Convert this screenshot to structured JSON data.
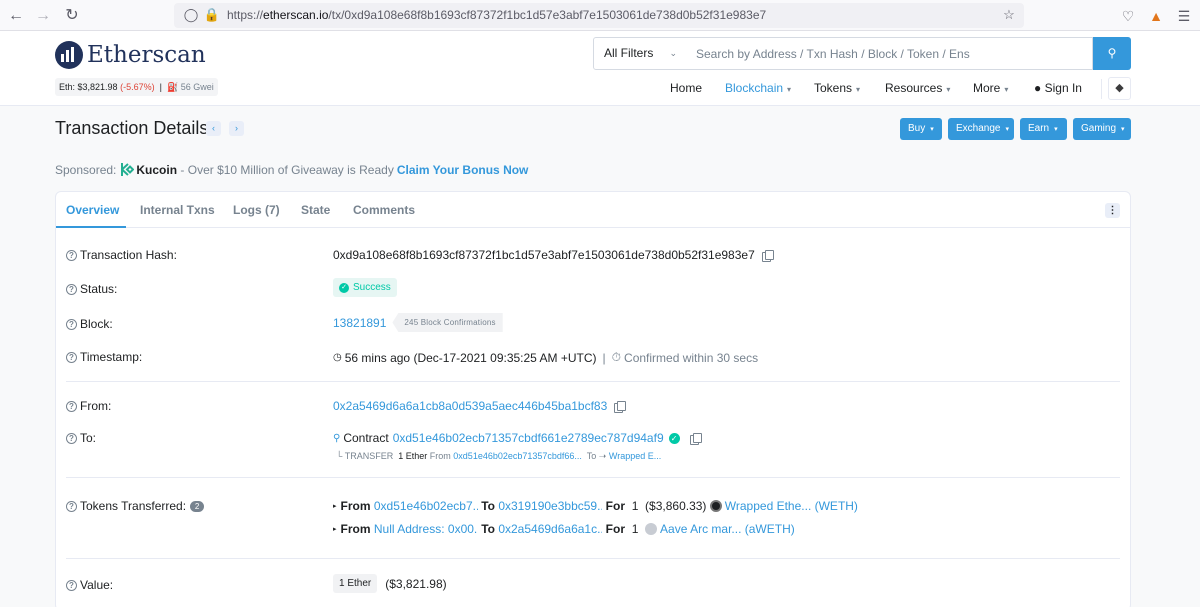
{
  "browser": {
    "url_prefix": "https://",
    "url_domain": "etherscan.io",
    "url_path": "/tx/0xd9a108e68f8b1693cf87372f1bc1d57e3abf7e1503061de738d0b52f31e983e7"
  },
  "header": {
    "logo_text": "Etherscan",
    "eth_price_label": "Eth: $3,821.98",
    "eth_change": "(-5.67%)",
    "separator": "|",
    "gas": "56 Gwei",
    "filter_label": "All Filters",
    "search_placeholder": "Search by Address / Txn Hash / Block / Token / Ens",
    "nav": {
      "home": "Home",
      "blockchain": "Blockchain",
      "tokens": "Tokens",
      "resources": "Resources",
      "more": "More",
      "signin": "Sign In"
    }
  },
  "page": {
    "title": "Transaction Details",
    "buttons": {
      "buy": "Buy",
      "exchange": "Exchange",
      "earn": "Earn",
      "gaming": "Gaming"
    }
  },
  "sponsored": {
    "label": "Sponsored:",
    "brand": "Kucoin",
    "text": "- Over $10 Million of Giveaway is Ready",
    "cta": "Claim Your Bonus Now"
  },
  "tabs": [
    "Overview",
    "Internal Txns",
    "Logs (7)",
    "State",
    "Comments"
  ],
  "details": {
    "hash_label": "Transaction Hash:",
    "hash": "0xd9a108e68f8b1693cf87372f1bc1d57e3abf7e1503061de738d0b52f31e983e7",
    "status_label": "Status:",
    "status": "Success",
    "block_label": "Block:",
    "block": "13821891",
    "confirmations": "245 Block Confirmations",
    "timestamp_label": "Timestamp:",
    "timestamp": "56 mins ago (Dec-17-2021 09:35:25 AM +UTC)",
    "ts_sep": "|",
    "confirmed_within": "Confirmed within 30 secs",
    "from_label": "From:",
    "from": "0x2a5469d6a6a1cb8a0d539a5aec446b45ba1bcf83",
    "to_label": "To:",
    "contract_label": "Contract",
    "to": "0xd51e46b02ecb71357cbdf661e2789ec787d94af9",
    "transfer_prefix": "└ TRANSFER",
    "transfer_amount": "1 Ether",
    "transfer_from_label": "From",
    "transfer_from": "0xd51e46b02ecb71357cbdf66...",
    "transfer_to_label": "To",
    "transfer_to": "Wrapped E...",
    "tokens_label": "Tokens Transferred:",
    "tokens_count": "2",
    "token_rows": [
      {
        "from_label": "From",
        "from": "0xd51e46b02ecb7...",
        "to_label": "To",
        "to": "0x319190e3bbc59...",
        "for_label": "For",
        "amount": "1",
        "usd": "($3,860.33)",
        "token": "Wrapped Ethe... (WETH)"
      },
      {
        "from_label": "From",
        "from": "Null Address: 0x00...",
        "to_label": "To",
        "to": "0x2a5469d6a6a1c...",
        "for_label": "For",
        "amount": "1",
        "usd": "",
        "token": "Aave Arc mar... (aWETH)"
      }
    ],
    "value_label": "Value:",
    "value": "1 Ether",
    "value_usd": "($3,821.98)"
  },
  "colors": {
    "accent": "#3498db",
    "success": "#00c9a7",
    "negative": "#de4437",
    "brand_dark": "#21325b"
  }
}
